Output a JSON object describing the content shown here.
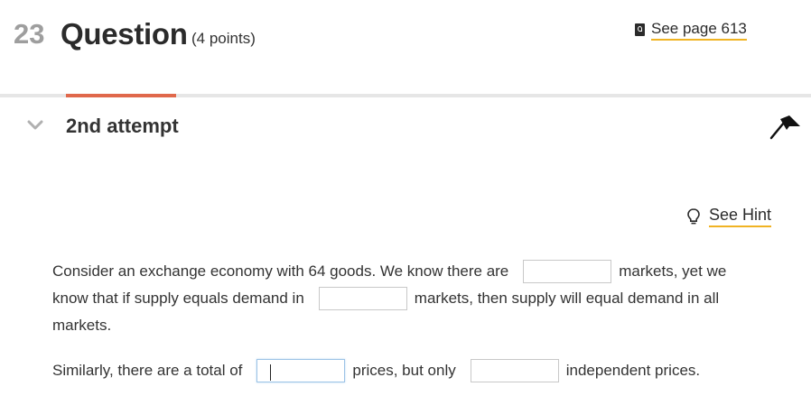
{
  "header": {
    "number": "23",
    "title": "Question",
    "points": "(4 points)",
    "reference_link": "See page 613",
    "reference_icon": "ebook-icon"
  },
  "attempt": {
    "label": "2nd attempt",
    "collapse_icon": "chevron-down-icon",
    "flag_icon": "flag-icon"
  },
  "hint": {
    "label": "See Hint",
    "icon": "lightbulb-icon"
  },
  "question": {
    "p1_a": "Consider an exchange economy with 64 goods. We know there are",
    "p1_b": "markets, yet we",
    "p1_c": "know that if supply equals demand in",
    "p1_d": "markets, then supply will equal demand in all",
    "p1_e": "markets.",
    "p2_a": "Similarly, there are a total of",
    "p2_b": "prices, but only",
    "p2_c": "independent prices.",
    "blanks": [
      {
        "value": ""
      },
      {
        "value": ""
      },
      {
        "value": ""
      },
      {
        "value": ""
      }
    ]
  },
  "colors": {
    "accent_tab": "#e0684b",
    "link_underline": "#f0b323",
    "divider": "#e6e6e6"
  }
}
